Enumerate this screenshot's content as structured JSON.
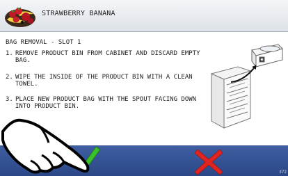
{
  "header": {
    "title": "STRAWBERRY BANANA",
    "icon": "strawberry-banana-fruit-icon"
  },
  "instructions": {
    "heading": "BAG REMOVAL - SLOT 1",
    "steps": [
      {
        "number": "1.",
        "text": "REMOVE PRODUCT BIN FROM CABINET AND DISCARD EMPTY BAG."
      },
      {
        "number": "2.",
        "text": "WIPE THE INSIDE OF THE PRODUCT BIN WITH A CLEAN TOWEL."
      },
      {
        "number": "3.",
        "text": "PLACE NEW PRODUCT BAG WITH THE SPOUT FACING DOWN INTO PRODUCT BIN."
      }
    ]
  },
  "footer": {
    "confirm_icon": "green-checkmark-icon",
    "cancel_icon": "red-x-icon",
    "page_number": "372"
  },
  "colors": {
    "footer": "#2b4787",
    "confirm": "#3bbf2a",
    "cancel": "#e0241f"
  }
}
